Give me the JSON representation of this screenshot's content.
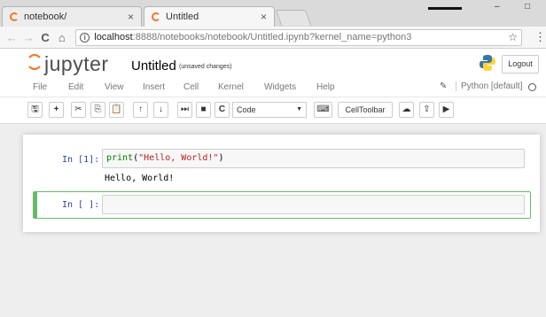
{
  "browser": {
    "tabs": [
      {
        "label": "notebook/",
        "close": "×"
      },
      {
        "label": "Untitled",
        "close": "×"
      }
    ],
    "window_controls": {
      "minimize": "–",
      "maximize": "□",
      "close": "✕"
    },
    "nav": {
      "back": "←",
      "forward": "→",
      "reload": "C",
      "home": "⌂"
    },
    "url_host": "localhost",
    "url_rest": ":8888/notebooks/notebook/Untitled.ipynb?kernel_name=python3",
    "star": "☆",
    "menu": "⋮"
  },
  "jupyter": {
    "logo_text": "jupyter",
    "notebook_title": "Untitled",
    "save_status": "(unsaved changes)",
    "logout_label": "Logout",
    "menu": [
      "File",
      "Edit",
      "View",
      "Insert",
      "Cell",
      "Kernel",
      "Widgets",
      "Help"
    ],
    "kernel_name": "Python [default]",
    "toolbar": {
      "save": "🖫",
      "add": "+",
      "cut": "✂",
      "copy": "⎘",
      "paste": "📋",
      "move_up": "↑",
      "move_down": "↓",
      "run": "⏭",
      "stop": "■",
      "restart": "C",
      "cell_type": "Code",
      "cell_type_caret": "▼",
      "keyboard": "⌨",
      "celltoolbar": "CellToolbar",
      "upload": "☁",
      "publish": "⇪",
      "present": "▶"
    }
  },
  "cells": [
    {
      "prompt": "In [1]:",
      "code_builtin": "print",
      "code_open": "(",
      "code_string": "\"Hello, World!\"",
      "code_close": ")",
      "output": "Hello, World!"
    },
    {
      "prompt": "In [ ]:",
      "code": ""
    }
  ],
  "colors": {
    "jupyter_orange": "#f37726",
    "prompt_blue": "#303f9f",
    "selected_green": "#66bb6a"
  }
}
